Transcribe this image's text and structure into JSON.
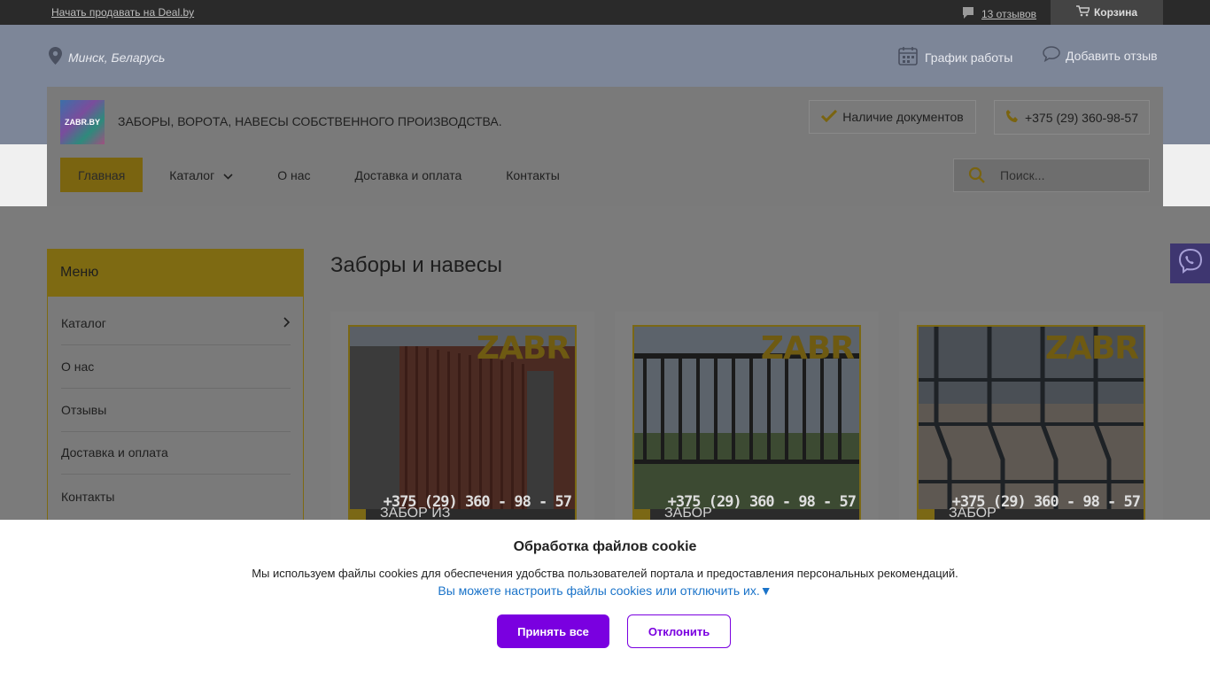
{
  "topbar": {
    "sell_link": "Начать продавать на Deal.by",
    "reviews_link": "13 отзывов",
    "cart_label": "Корзина"
  },
  "header": {
    "location": "Минск, Беларусь",
    "schedule_label": "График работы",
    "add_review_label": "Добавить отзыв",
    "logo_text": "ZABR.BY",
    "slogan": "ЗАБОРЫ, ВОРОТА, НАВЕСЫ СОБСТВЕННОГО ПРОИЗВОДСТВА.",
    "docs_label": "Наличие документов",
    "phone": "+375 (29) 360-98-57"
  },
  "nav": {
    "items": [
      {
        "label": "Главная"
      },
      {
        "label": "Каталог"
      },
      {
        "label": "О нас"
      },
      {
        "label": "Доставка и оплата"
      },
      {
        "label": "Контакты"
      }
    ],
    "search_placeholder": "Поиск..."
  },
  "sidebar": {
    "title": "Меню",
    "items": [
      {
        "label": "Каталог"
      },
      {
        "label": "О нас"
      },
      {
        "label": "Отзывы"
      },
      {
        "label": "Доставка и оплата"
      },
      {
        "label": "Контакты"
      }
    ]
  },
  "main": {
    "section_title": "Заборы и навесы",
    "products": [
      {
        "brand": "ZABR",
        "phone": "+375 (29) 360 - 98 - 57",
        "caption": "ЗАБОР ИЗ"
      },
      {
        "brand": "ZABR",
        "phone": "+375 (29) 360 - 98 - 57",
        "caption": "ЗАБОР"
      },
      {
        "brand": "ZABR",
        "phone": "+375 (29) 360 - 98 - 57",
        "caption": "ЗАБОР"
      }
    ]
  },
  "cookie": {
    "title": "Обработка файлов cookie",
    "text": "Мы используем файлы cookies для обеспечения удобства пользователей портала и предоставления персональных рекомендаций.",
    "settings_link": "Вы можете настроить файлы cookies или отключить их.▼",
    "accept_label": "Принять все",
    "decline_label": "Отклонить"
  },
  "colors": {
    "accent": "#F0C20F",
    "cookie_button": "#7A00E0",
    "link": "#1A73C9"
  }
}
